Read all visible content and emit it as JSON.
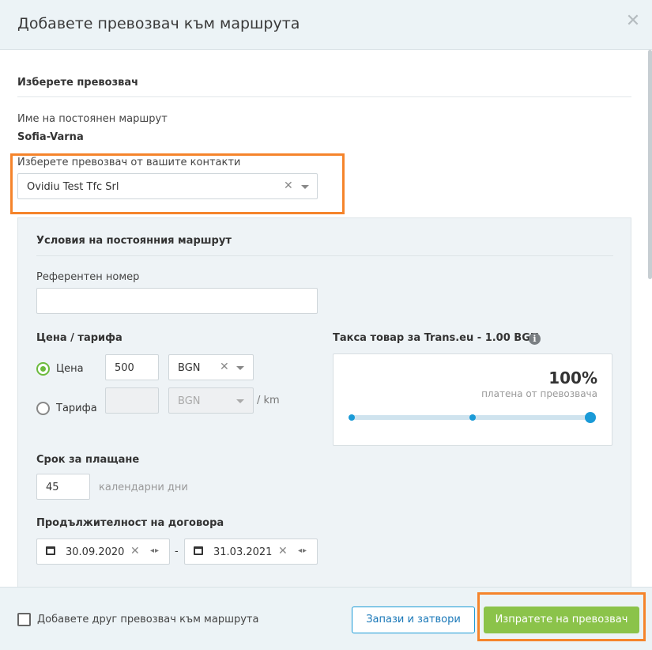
{
  "header": {
    "title": "Добавете превозвач към маршрута"
  },
  "section": {
    "title": "Изберете превозвач"
  },
  "route": {
    "label": "Име на постоянен маршрут",
    "name": "Sofia-Varna"
  },
  "carrier": {
    "label": "Изберете превозвач от вашите контакти",
    "value": "Ovidiu Test Tfc Srl"
  },
  "conditions": {
    "title": "Условия на постоянния маршрут",
    "reference": {
      "label": "Референтен номер",
      "value": ""
    },
    "price_section": {
      "title": "Цена / тарифа",
      "price_option": {
        "label": "Цена",
        "checked": true,
        "amount": "500",
        "currency": "BGN"
      },
      "rate_option": {
        "label": "Тарифа",
        "checked": false,
        "amount": "",
        "currency": "BGN",
        "unit": "/ km"
      }
    },
    "fee": {
      "title": "Такса товар за Trans.eu - 1.00 BGN",
      "percent": "100%",
      "caption": "платена от превозвача",
      "slider_level": 1.0
    },
    "payment_term": {
      "title": "Срок за плащане",
      "value": "45",
      "unit": "календарни дни"
    },
    "contract_duration": {
      "title": "Продължителност на договора",
      "from": "30.09.2020",
      "separator": "-",
      "to": "31.03.2021"
    }
  },
  "footer": {
    "add_carrier_label": "Добавете друг превозвач към маршрута",
    "save_close_label": "Запази и затвори",
    "send_label": "Изпратете на превозвач"
  },
  "colors": {
    "accent": "#1a9ad7",
    "primary_button": "#8bc34a",
    "highlight": "#f5842b",
    "radio_checked": "#6cba3d"
  },
  "icons": {
    "close": "close-icon",
    "info": "info-icon",
    "calendar": "calendar-icon",
    "clear": "clear-icon",
    "caret": "chevron-down-icon"
  }
}
